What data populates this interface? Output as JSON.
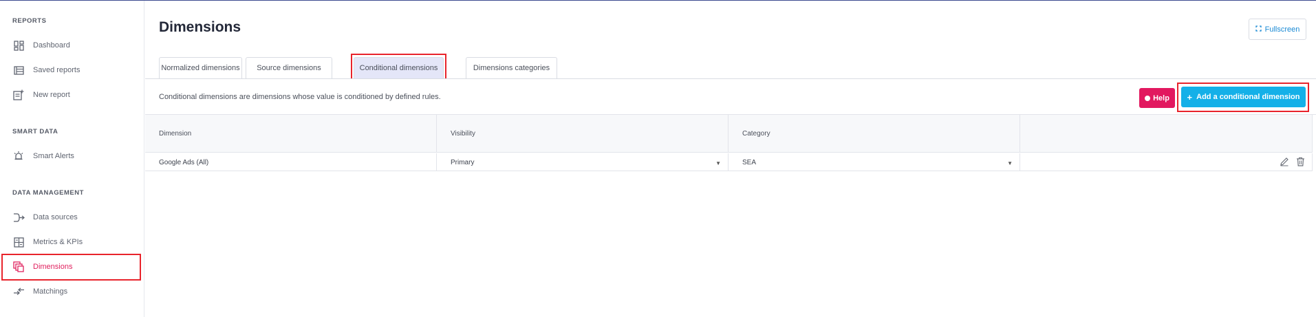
{
  "sidebar": {
    "sections": [
      {
        "title": "REPORTS"
      },
      {
        "title": "SMART DATA"
      },
      {
        "title": "DATA MANAGEMENT"
      }
    ],
    "items": [
      {
        "label": "Dashboard",
        "icon": "dashboard-icon"
      },
      {
        "label": "Saved reports",
        "icon": "list-icon"
      },
      {
        "label": "New report",
        "icon": "new-report-icon"
      },
      {
        "label": "Smart Alerts",
        "icon": "alarm-icon"
      },
      {
        "label": "Data sources",
        "icon": "data-sources-icon"
      },
      {
        "label": "Metrics & KPIs",
        "icon": "calculator-icon"
      },
      {
        "label": "Dimensions",
        "icon": "dimensions-icon",
        "active": true
      },
      {
        "label": "Matchings",
        "icon": "matching-icon"
      }
    ]
  },
  "header": {
    "title": "Dimensions",
    "fullscreen_label": "Fullscreen"
  },
  "tabs": [
    {
      "label": "Normalized dimensions"
    },
    {
      "label": "Source dimensions"
    },
    {
      "label": "Conditional dimensions",
      "active": true
    },
    {
      "label": "Dimensions categories"
    }
  ],
  "description": "Conditional dimensions are dimensions whose value is conditioned by defined rules.",
  "buttons": {
    "help_label": "Help",
    "add_label": "Add a conditional dimension"
  },
  "table": {
    "columns": [
      "Dimension",
      "Visibility",
      "Category",
      ""
    ],
    "rows": [
      {
        "dimension": "Google Ads (All)",
        "visibility": "Primary",
        "category": "SEA"
      }
    ]
  },
  "colors": {
    "accent": "#e0225f",
    "primary_button": "#14b0e8",
    "help_button": "#e2185f",
    "highlight": "#e8232b"
  }
}
